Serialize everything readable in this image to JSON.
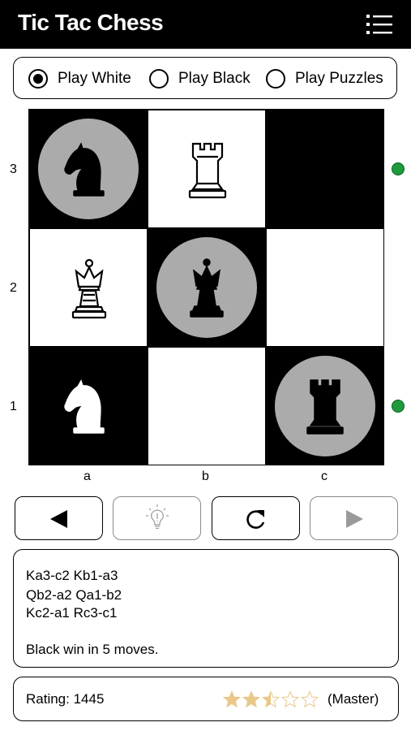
{
  "app": {
    "title": "Tic Tac Chess"
  },
  "modes": [
    {
      "label": "Play White",
      "selected": true
    },
    {
      "label": "Play Black",
      "selected": false
    },
    {
      "label": "Play Puzzles",
      "selected": false
    }
  ],
  "board": {
    "ranks": [
      "3",
      "2",
      "1"
    ],
    "files": [
      "a",
      "b",
      "c"
    ],
    "squares": [
      {
        "square": "a3",
        "shade": "dark",
        "piece": "knight",
        "color": "black",
        "highlight": true
      },
      {
        "square": "b3",
        "shade": "light",
        "piece": "rook",
        "color": "white",
        "highlight": false
      },
      {
        "square": "c3",
        "shade": "dark",
        "piece": null,
        "color": null,
        "highlight": false
      },
      {
        "square": "a2",
        "shade": "light",
        "piece": "queen",
        "color": "white",
        "highlight": false
      },
      {
        "square": "b2",
        "shade": "dark",
        "piece": "queen",
        "color": "black",
        "highlight": true
      },
      {
        "square": "c2",
        "shade": "light",
        "piece": null,
        "color": null,
        "highlight": false
      },
      {
        "square": "a1",
        "shade": "dark",
        "piece": "knight",
        "color": "white",
        "highlight": false
      },
      {
        "square": "b1",
        "shade": "light",
        "piece": null,
        "color": null,
        "highlight": false
      },
      {
        "square": "c1",
        "shade": "dark",
        "piece": "rook",
        "color": "black",
        "highlight": true
      }
    ],
    "win_markers": [
      "3",
      "1"
    ],
    "marker_color": "#1e9a3c"
  },
  "controls": [
    {
      "name": "back-button",
      "icon": "triangle-left-icon",
      "enabled": true
    },
    {
      "name": "hint-button",
      "icon": "lightbulb-icon",
      "enabled": false
    },
    {
      "name": "restart-button",
      "icon": "refresh-icon",
      "enabled": true
    },
    {
      "name": "forward-button",
      "icon": "triangle-right-icon",
      "enabled": false
    }
  ],
  "moves": {
    "lines": [
      "Ka3-c2   Kb1-a3",
      "Qb2-a2   Qa1-b2",
      "Kc2-a1   Rc3-c1"
    ],
    "result": "Black win in 5 moves."
  },
  "rating": {
    "label": "Rating: 1445",
    "stars": 2.5,
    "max_stars": 5,
    "star_color": "#e9c88a",
    "level": "(Master)"
  }
}
